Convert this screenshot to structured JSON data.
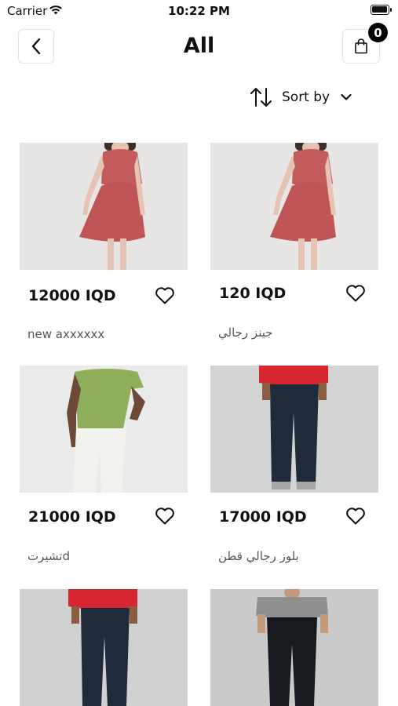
{
  "status_bar": {
    "carrier": "Carrier",
    "time": "10:22 PM"
  },
  "header": {
    "title": "All",
    "cart_count": "0"
  },
  "sort": {
    "label": "Sort by"
  },
  "products": [
    {
      "price": "12000 IQD",
      "name": "new axxxxxx",
      "image": "red-dress"
    },
    {
      "price": "120 IQD",
      "name": "جينز رجالي",
      "image": "red-dress"
    },
    {
      "price": "21000 IQD",
      "name": "تشيرتd",
      "image": "green-tshirt-white-pants"
    },
    {
      "price": "17000 IQD",
      "name": "بلوز رجالي قطن",
      "image": "dark-jeans-red-sweater"
    },
    {
      "price": "",
      "name": "",
      "image": "dark-jeans-red-sweater"
    },
    {
      "price": "",
      "name": "",
      "image": "black-jeans-grey-sweater"
    }
  ]
}
